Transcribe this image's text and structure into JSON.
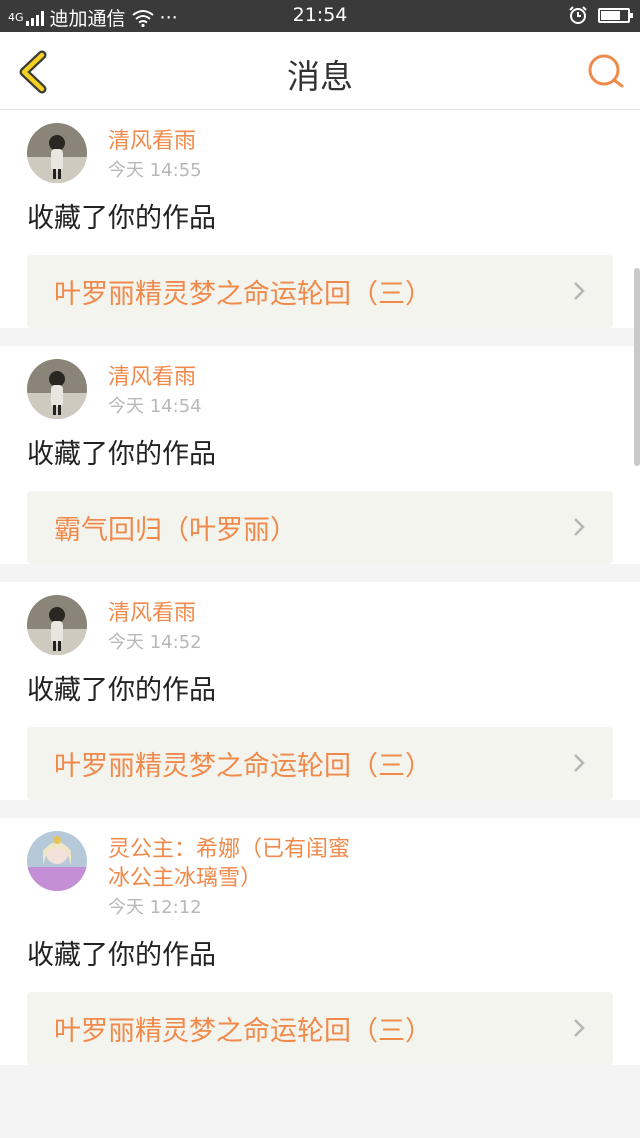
{
  "status_bar": {
    "network": "4G",
    "carrier": "迪加通信",
    "dots": "···",
    "time": "21:54",
    "battery_percent": 80
  },
  "header": {
    "title": "消息"
  },
  "theme": {
    "accent": "#f08a4b",
    "back_arrow": "#f5d21f"
  },
  "messages": [
    {
      "user": "清风看雨",
      "time": "今天 14:55",
      "action": "收藏了你的作品",
      "work_title": "叶罗丽精灵梦之命运轮回（三）"
    },
    {
      "user": "清风看雨",
      "time": "今天 14:54",
      "action": "收藏了你的作品",
      "work_title": "霸气回归（叶罗丽）"
    },
    {
      "user": "清风看雨",
      "time": "今天 14:52",
      "action": "收藏了你的作品",
      "work_title": "叶罗丽精灵梦之命运轮回（三）"
    },
    {
      "user": "灵公主：希娜（已有闺蜜 冰公主冰璃雪）",
      "user_line1": "灵公主：希娜（已有闺蜜",
      "user_line2": "冰公主冰璃雪）",
      "time": "今天 12:12",
      "action": "收藏了你的作品",
      "work_title": "叶罗丽精灵梦之命运轮回（三）"
    }
  ],
  "icons": [
    "signal-icon",
    "wifi-icon",
    "alarm-icon",
    "battery-icon",
    "back-arrow-icon",
    "search-icon",
    "chevron-right-icon"
  ]
}
